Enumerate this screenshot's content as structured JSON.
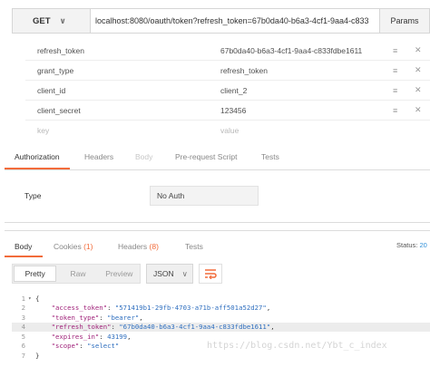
{
  "request": {
    "method": "GET",
    "url": "localhost:8080/oauth/token?refresh_token=67b0da40-b6a3-4cf1-9aa4-c833",
    "params_label": "Params"
  },
  "params": [
    {
      "key": "refresh_token",
      "value": "67b0da40-b6a3-4cf1-9aa4-c833fdbe1611"
    },
    {
      "key": "grant_type",
      "value": "refresh_token"
    },
    {
      "key": "client_id",
      "value": "client_2"
    },
    {
      "key": "client_secret",
      "value": "123456"
    }
  ],
  "params_placeholder": {
    "key": "key",
    "value": "value"
  },
  "request_tabs": {
    "authorization": "Authorization",
    "headers": "Headers",
    "body": "Body",
    "pre_request": "Pre-request Script",
    "tests": "Tests"
  },
  "auth": {
    "type_label": "Type",
    "type_value": "No Auth"
  },
  "response_tabs": {
    "body": "Body",
    "cookies": "Cookies",
    "cookies_count": "(1)",
    "headers": "Headers",
    "headers_count": "(8)",
    "tests": "Tests"
  },
  "status": {
    "label": "Status:",
    "value": "20"
  },
  "view": {
    "pretty": "Pretty",
    "raw": "Raw",
    "preview": "Preview",
    "format": "JSON"
  },
  "code_lines": [
    {
      "n": "1",
      "fold": "▾",
      "text": "{"
    },
    {
      "n": "2",
      "key": "\"access_token\"",
      "val": "\"571419b1-29fb-4703-a71b-aff501a52d27\"",
      "tail": ","
    },
    {
      "n": "3",
      "key": "\"token_type\"",
      "val": "\"bearer\"",
      "tail": ","
    },
    {
      "n": "4",
      "key": "\"refresh_token\"",
      "val": "\"67b0da40-b6a3-4cf1-9aa4-c833fdbe1611\"",
      "tail": ","
    },
    {
      "n": "5",
      "key": "\"expires_in\"",
      "val": "43199",
      "tail": ","
    },
    {
      "n": "6",
      "key": "\"scope\"",
      "val": "\"select\"",
      "tail": ""
    },
    {
      "n": "7",
      "text": "}"
    }
  ],
  "watermark": "https://blog.csdn.net/Ybt_c_index",
  "colors": {
    "accent": "#f26b3a",
    "json_key": "#a0237a",
    "json_value": "#2f6fbf"
  }
}
